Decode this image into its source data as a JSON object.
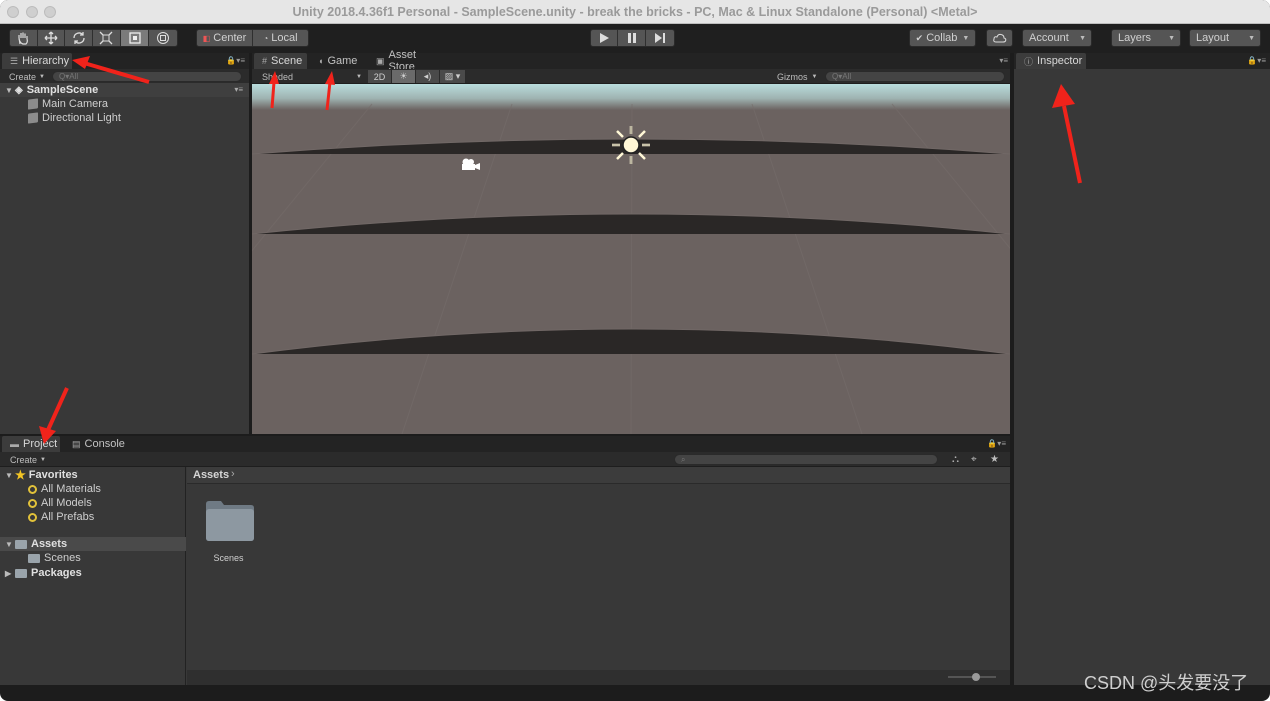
{
  "window": {
    "title": "Unity 2018.4.36f1 Personal - SampleScene.unity - break the bricks - PC, Mac & Linux Standalone (Personal) <Metal>"
  },
  "toolbar": {
    "tools": [
      "hand-tool",
      "move-tool",
      "rotate-tool",
      "scale-tool",
      "rect-tool",
      "transform-tool"
    ],
    "pivot_label": "Center",
    "space_label": "Local",
    "play_icons": [
      "play-icon",
      "pause-icon",
      "step-icon"
    ],
    "collab_label": "Collab",
    "account_label": "Account",
    "layers_label": "Layers",
    "layout_label": "Layout"
  },
  "hierarchy": {
    "tab_label": "Hierarchy",
    "create_label": "Create",
    "search_placeholder": "Q▾All",
    "scene_name": "SampleScene",
    "items": [
      {
        "label": "Main Camera"
      },
      {
        "label": "Directional Light"
      }
    ]
  },
  "scene_view": {
    "tabs": [
      {
        "label": "Scene"
      },
      {
        "label": "Game"
      },
      {
        "label": "Asset Store"
      }
    ],
    "shading_label": "Shaded",
    "mode_2d_label": "2D",
    "gizmos_label": "Gizmos",
    "search_placeholder": "Q▾All"
  },
  "inspector": {
    "tab_label": "Inspector"
  },
  "project": {
    "tabs": [
      {
        "label": "Project"
      },
      {
        "label": "Console"
      }
    ],
    "create_label": "Create",
    "favorites_label": "Favorites",
    "favorites": [
      {
        "label": "All Materials"
      },
      {
        "label": "All Models"
      },
      {
        "label": "All Prefabs"
      }
    ],
    "assets_label": "Assets",
    "assets_children": [
      {
        "label": "Scenes"
      }
    ],
    "packages_label": "Packages",
    "breadcrumb": "Assets",
    "grid_items": [
      {
        "label": "Scenes"
      }
    ]
  },
  "watermark": "CSDN @头发要没了",
  "colors": {
    "sky": "#b9dcdc",
    "ground": "#6b6260",
    "annotation_arrow": "#f0231b"
  }
}
